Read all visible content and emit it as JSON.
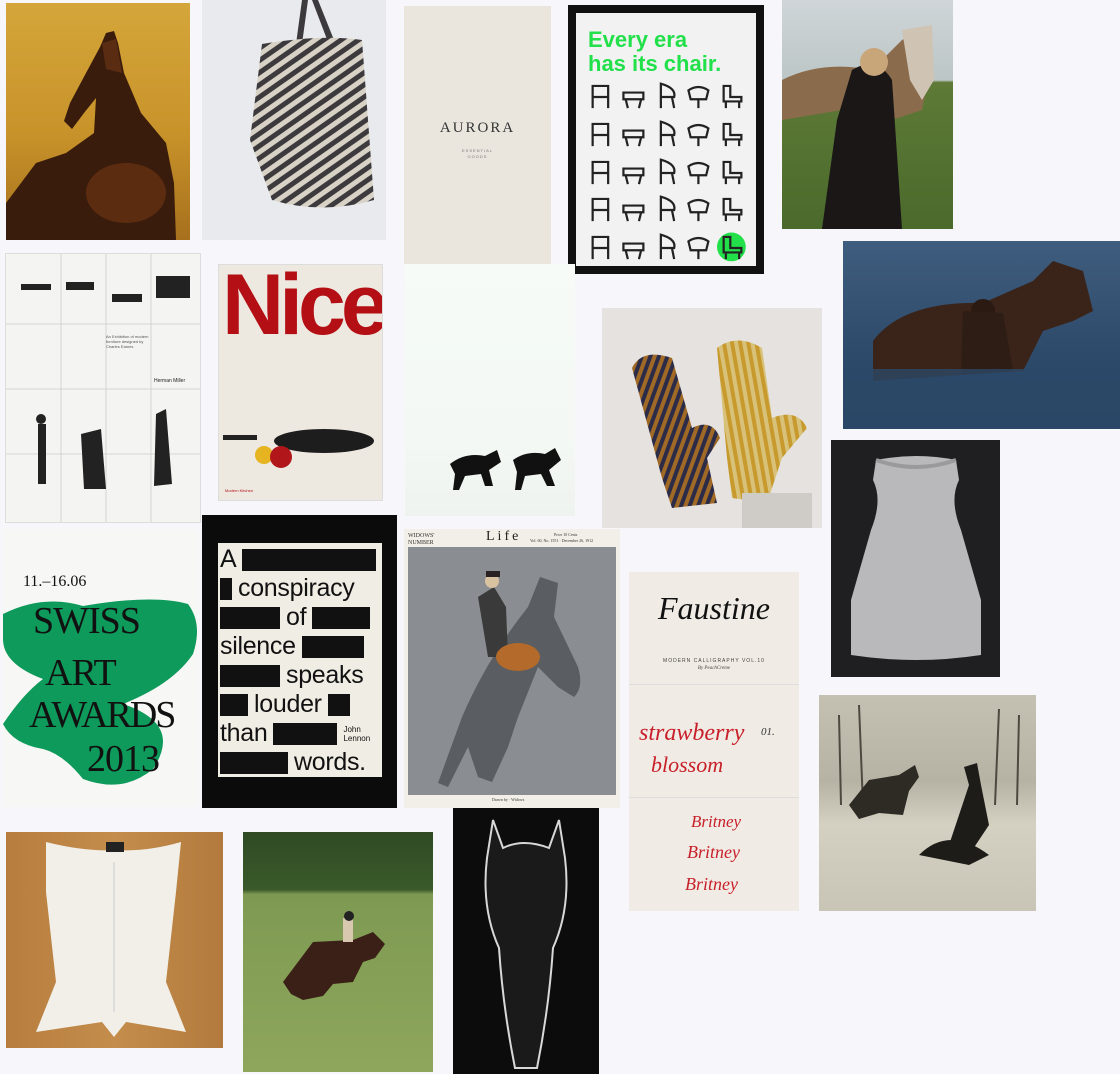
{
  "board": {
    "background": "#f7f6fa",
    "accent_green": "#22e04a",
    "swiss_green": "#0d9a5a",
    "nice_red": "#b40f14"
  },
  "tiles": {
    "horse_gold": {
      "icon": "horse-silhouette-icon"
    },
    "striped_bag": {
      "icon": "knit-bag-icon"
    },
    "aurora": {
      "brand": "AURORA",
      "subline_1": "ESSENTIAL",
      "subline_2": "GOODS"
    },
    "chairs": {
      "headline_1": "Every era",
      "headline_2": "has its chair.",
      "headline_color": "#22e04a"
    },
    "woman_horse": {
      "icon": "horse-icon"
    },
    "swimming_horse": {
      "icon": "horse-icon"
    },
    "eames_poster": {
      "brand": "Herman Miller",
      "body": "An Exhibition of modern furniture designed by Charles Eames"
    },
    "nice_poster": {
      "title": "Nice",
      "footer": "Modern Kitchen"
    },
    "snow_horses": {
      "icon": "horses-icon"
    },
    "mittens": {
      "icon": "mittens-icon"
    },
    "knit_top": {
      "icon": "knit-top-icon"
    },
    "swiss_art": {
      "dates": "11.–16.06",
      "line_1": "SWISS",
      "line_2": "ART",
      "line_3": "AWARDS",
      "line_4": "2013"
    },
    "conspiracy": {
      "w1": "A",
      "w2": "conspiracy",
      "w3": "of",
      "w4": "silence",
      "w5": "speaks",
      "w6": "louder",
      "w7": "than",
      "w8": "words.",
      "author_1": "John",
      "author_2": "Lennon"
    },
    "life_cover": {
      "left_1": "WIDOWS'",
      "left_2": "NUMBER",
      "masthead": "Life",
      "right_1": "Price 10 Cents",
      "right_2": "Vol. 60, No. 1551 · December 26, 1912",
      "footer": "Drawn by · Widows"
    },
    "faustine": {
      "title": "Faustine",
      "subtitle": "MODERN CALLIGRAPHY VOL.10",
      "byline": "By PeachCreme",
      "script_1": "strawberry",
      "script_2": "blossom",
      "number": "01.",
      "name_1": "Britney",
      "name_2": "Britney",
      "name_3": "Britney"
    },
    "rider_dark": {
      "icon": "horse-rider-icon"
    },
    "white_corset": {
      "icon": "corset-icon"
    },
    "galloping_rider": {
      "icon": "horse-rider-icon"
    },
    "dark_horse_head": {
      "icon": "horse-head-icon"
    }
  }
}
